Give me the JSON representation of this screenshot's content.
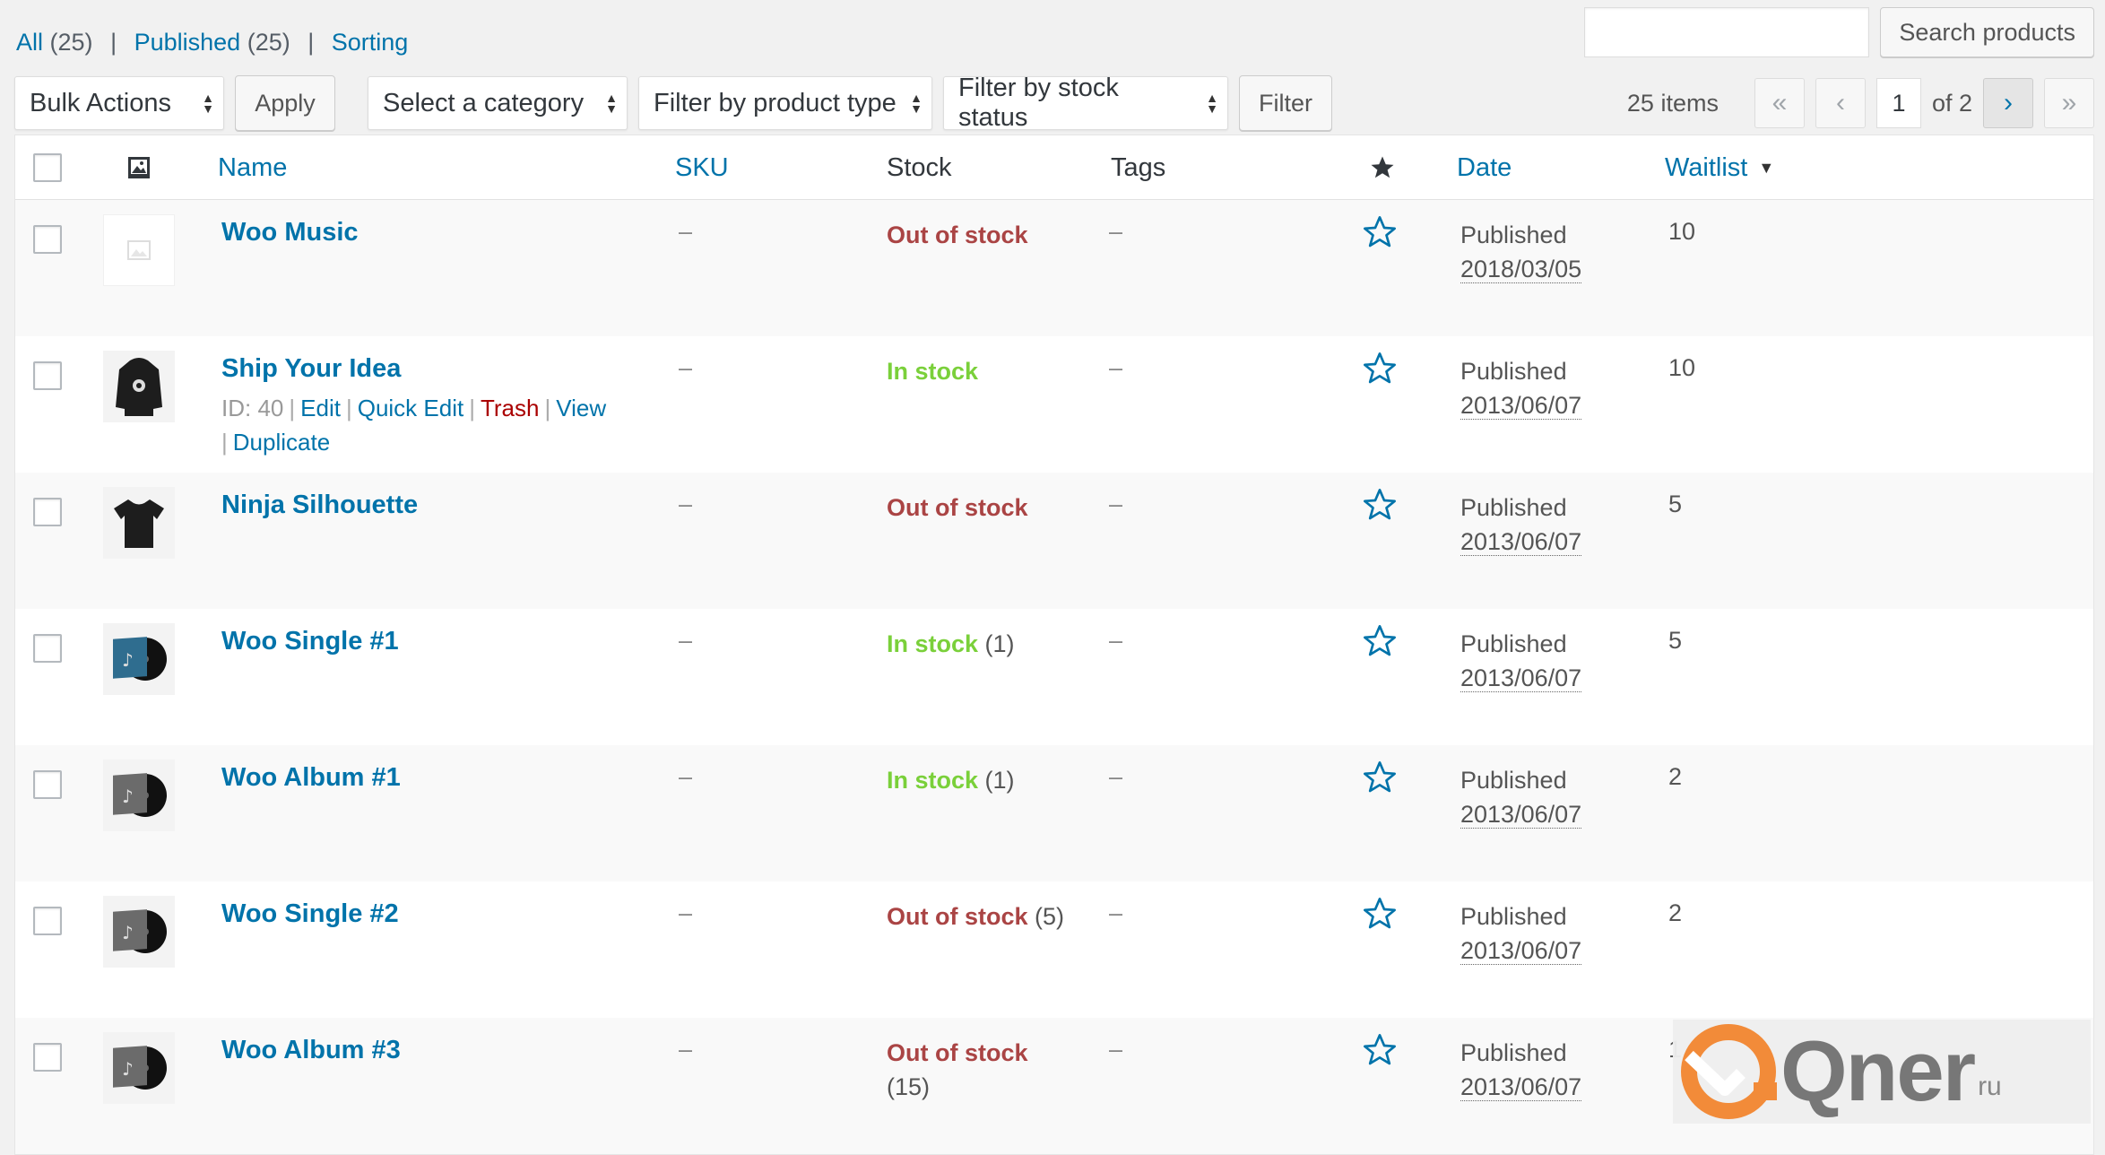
{
  "filters": {
    "all_label": "All",
    "all_count": "(25)",
    "published_label": "Published",
    "published_count": "(25)",
    "sorting_label": "Sorting"
  },
  "search": {
    "button": "Search products",
    "value": ""
  },
  "toolbar": {
    "bulk_actions": "Bulk Actions",
    "apply": "Apply",
    "category": "Select a category",
    "product_type": "Filter by product type",
    "stock_status": "Filter by stock status",
    "filter": "Filter"
  },
  "pagination": {
    "items": "25 items",
    "first": "«",
    "prev": "‹",
    "current": "1",
    "of": "of 2",
    "next": "›",
    "last": "»"
  },
  "columns": {
    "name": "Name",
    "sku": "SKU",
    "stock": "Stock",
    "tags": "Tags",
    "date": "Date",
    "waitlist": "Waitlist"
  },
  "rows": [
    {
      "name": "Woo Music",
      "sku": "–",
      "stock": "Out of stock",
      "stock_type": "out",
      "stock_count": "",
      "tags": "–",
      "date_status": "Published",
      "date": "2018/03/05",
      "waitlist": "10",
      "thumb": "placeholder"
    },
    {
      "name": "Ship Your Idea",
      "sku": "–",
      "stock": "In stock",
      "stock_type": "in",
      "stock_count": "",
      "tags": "–",
      "date_status": "Published",
      "date": "2013/06/07",
      "waitlist": "10",
      "thumb": "hoodie",
      "actions": {
        "id": "ID: 40",
        "edit": "Edit",
        "quick_edit": "Quick Edit",
        "trash": "Trash",
        "view": "View",
        "duplicate": "Duplicate"
      }
    },
    {
      "name": "Ninja Silhouette",
      "sku": "–",
      "stock": "Out of stock",
      "stock_type": "out",
      "stock_count": "",
      "tags": "–",
      "date_status": "Published",
      "date": "2013/06/07",
      "waitlist": "5",
      "thumb": "tshirt"
    },
    {
      "name": "Woo Single #1",
      "sku": "–",
      "stock": "In stock",
      "stock_type": "in",
      "stock_count": "(1)",
      "tags": "–",
      "date_status": "Published",
      "date": "2013/06/07",
      "waitlist": "5",
      "thumb": "vinyl-blue"
    },
    {
      "name": "Woo Album #1",
      "sku": "–",
      "stock": "In stock",
      "stock_type": "in",
      "stock_count": "(1)",
      "tags": "–",
      "date_status": "Published",
      "date": "2013/06/07",
      "waitlist": "2",
      "thumb": "vinyl-grey"
    },
    {
      "name": "Woo Single #2",
      "sku": "–",
      "stock": "Out of stock",
      "stock_type": "out",
      "stock_count": "(5)",
      "tags": "–",
      "date_status": "Published",
      "date": "2013/06/07",
      "waitlist": "2",
      "thumb": "vinyl-grey"
    },
    {
      "name": "Woo Album #3",
      "sku": "–",
      "stock": "Out of stock",
      "stock_type": "out",
      "stock_count": "(15)",
      "tags": "–",
      "date_status": "Published",
      "date": "2013/06/07",
      "waitlist": "1",
      "thumb": "vinyl-grey"
    }
  ],
  "watermark": {
    "brand": "Qner",
    "tld": "ru"
  },
  "colors": {
    "link": "#0073aa",
    "out_of_stock": "#a44444",
    "in_stock": "#7ad03a",
    "trash": "#aa0000"
  }
}
